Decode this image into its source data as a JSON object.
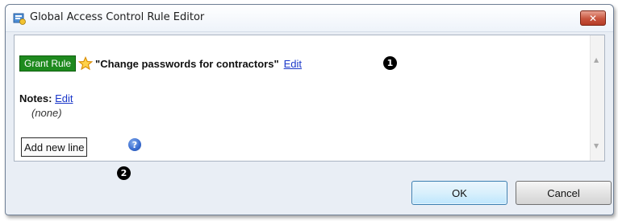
{
  "window": {
    "title": "Global Access Control Rule Editor",
    "close_label": "✕"
  },
  "rule": {
    "badge": "Grant Rule",
    "name": "\"Change passwords for contractors\"",
    "edit_label": "Edit"
  },
  "notes": {
    "label": "Notes:",
    "edit_label": "Edit",
    "value": "(none)"
  },
  "actions": {
    "add_line_label": "Add new line",
    "help_glyph": "?",
    "ok_label": "OK",
    "cancel_label": "Cancel"
  },
  "callouts": {
    "one": "1",
    "two": "2"
  },
  "icons": {
    "app": "rule-editor-app-icon",
    "star": "star-icon",
    "help": "help-icon",
    "close": "close-icon"
  },
  "colors": {
    "grant_badge": "#1e8a1e",
    "link": "#1a37c9",
    "close_button": "#c8543d"
  }
}
